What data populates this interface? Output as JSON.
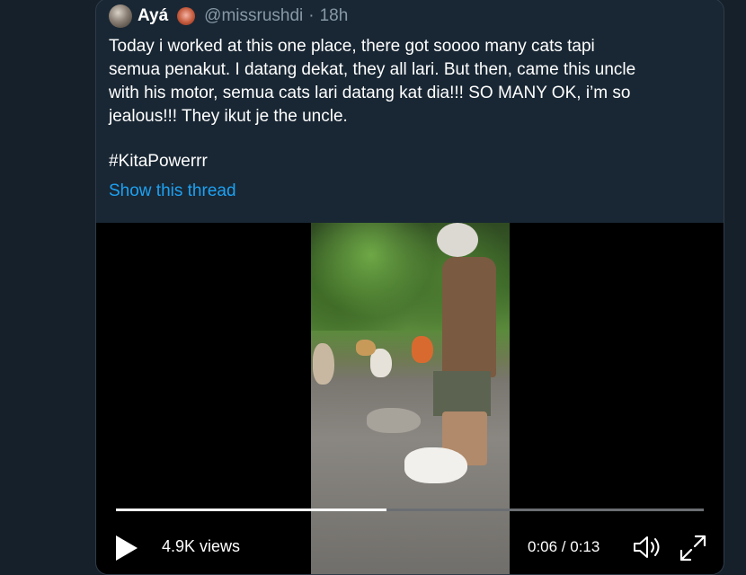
{
  "tweet": {
    "display_name": "Ayá",
    "handle": "@missrushdi",
    "separator": "·",
    "time": "18h",
    "text": "Today i worked at this one place, there got soooo many cats tapi\nsemua penakut. I datang dekat, they all lari. But then, came this uncle\nwith his motor, semua cats lari datang kat dia!!! SO MANY OK, i’m so\njealous!!! They ikut je the uncle.",
    "hashtag": "#KitaPowerrr",
    "show_thread": "Show this thread",
    "avatar_icon": "avatar-icon",
    "badge_icon": "monkey-emoji-icon"
  },
  "video": {
    "views": "4.9K views",
    "timecode": "0:06 / 0:13",
    "progress": 0.46,
    "play_icon": "play-icon",
    "volume_icon": "speaker-icon",
    "fullscreen_icon": "expand-icon"
  },
  "colors": {
    "background": "#15202b",
    "card": "#192734",
    "link": "#1da1f2",
    "muted": "#8899a6"
  }
}
